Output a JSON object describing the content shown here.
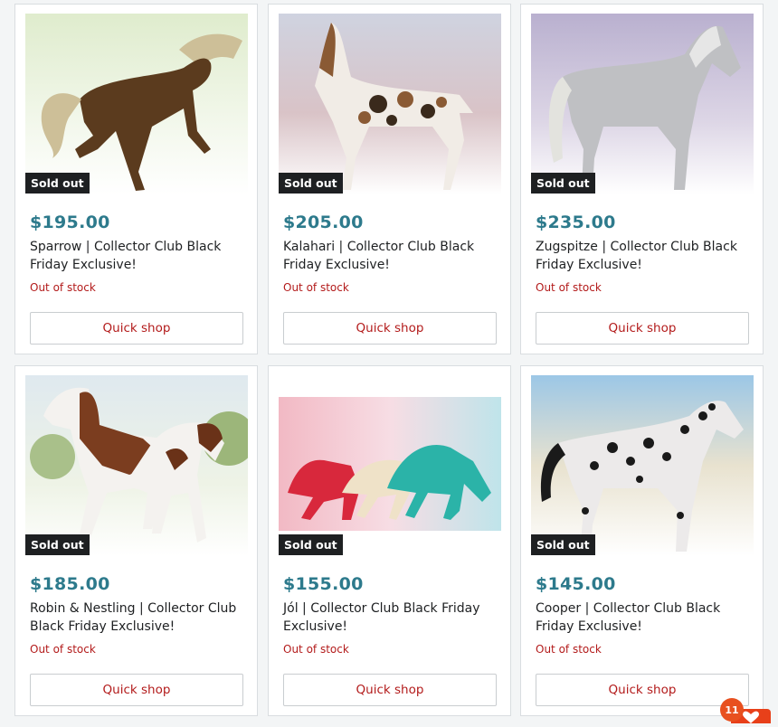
{
  "products": [
    {
      "price": "$195.00",
      "title": "Sparrow | Collector Club Black Friday Exclusive!",
      "badge": "Sold out",
      "stock": "Out of stock",
      "action": "Quick shop"
    },
    {
      "price": "$205.00",
      "title": "Kalahari | Collector Club Black Friday Exclusive!",
      "badge": "Sold out",
      "stock": "Out of stock",
      "action": "Quick shop"
    },
    {
      "price": "$235.00",
      "title": "Zugspitze | Collector Club Black Friday Exclusive!",
      "badge": "Sold out",
      "stock": "Out of stock",
      "action": "Quick shop"
    },
    {
      "price": "$185.00",
      "title": "Robin & Nestling | Collector Club Black Friday Exclusive!",
      "badge": "Sold out",
      "stock": "Out of stock",
      "action": "Quick shop"
    },
    {
      "price": "$155.00",
      "title": "Jól | Collector Club Black Friday Exclusive!",
      "badge": "Sold out",
      "stock": "Out of stock",
      "action": "Quick shop"
    },
    {
      "price": "$145.00",
      "title": "Cooper | Collector Club Black Friday Exclusive!",
      "badge": "Sold out",
      "stock": "Out of stock",
      "action": "Quick shop"
    }
  ],
  "notification": {
    "count": "11"
  },
  "colors": {
    "price": "#2d7a8c",
    "stock": "#b31b1b",
    "badge_bg": "#1e2022",
    "notification": "#e8501f"
  }
}
